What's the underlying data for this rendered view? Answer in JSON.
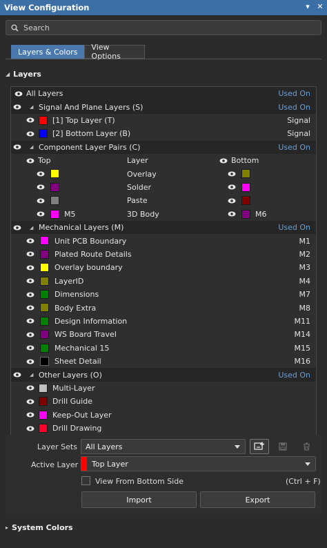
{
  "title": "View Configuration",
  "search": {
    "placeholder": "Search"
  },
  "tabs": [
    {
      "label": "Layers & Colors",
      "active": true
    },
    {
      "label": "View Options",
      "active": false
    }
  ],
  "layers_section": {
    "title": "Layers",
    "all_layers": {
      "label": "All Layers",
      "right": "Used On"
    },
    "signal_group": {
      "label": "Signal And Plane Layers (S)",
      "right": "Used On",
      "items": [
        {
          "label": "[1] Top Layer (T)",
          "color": "#ff0000",
          "right": "Signal"
        },
        {
          "label": "[2] Bottom Layer (B)",
          "color": "#0000ff",
          "right": "Signal"
        }
      ]
    },
    "pairs_group": {
      "label": "Component Layer Pairs (C)",
      "right": "Used On",
      "header": {
        "top": "Top",
        "layer": "Layer",
        "bottom": "Bottom"
      },
      "items": [
        {
          "top_color": "#ffff00",
          "top_label": "",
          "layer": "Overlay",
          "bottom_color": "#808000",
          "bottom_label": ""
        },
        {
          "top_color": "#800080",
          "top_label": "",
          "layer": "Solder",
          "bottom_color": "#ff00ff",
          "bottom_label": ""
        },
        {
          "top_color": "#808080",
          "top_label": "",
          "layer": "Paste",
          "bottom_color": "#800000",
          "bottom_label": ""
        },
        {
          "top_color": "#ff00ff",
          "top_label": "M5",
          "layer": "3D Body",
          "bottom_color": "#800080",
          "bottom_label": "M6"
        }
      ]
    },
    "mech_group": {
      "label": "Mechanical Layers (M)",
      "right": "Used On",
      "items": [
        {
          "label": "Unit PCB Boundary",
          "color": "#ff00ff",
          "right": "M1"
        },
        {
          "label": "Plated Route Details",
          "color": "#800080",
          "right": "M2"
        },
        {
          "label": "Overlay boundary",
          "color": "#ffff00",
          "right": "M3"
        },
        {
          "label": "LayerID",
          "color": "#808000",
          "right": "M4"
        },
        {
          "label": "Dimensions",
          "color": "#008000",
          "right": "M7"
        },
        {
          "label": "Body Extra",
          "color": "#808000",
          "right": "M8"
        },
        {
          "label": "Design Information",
          "color": "#008000",
          "right": "M11"
        },
        {
          "label": "WS Board Travel",
          "color": "#800080",
          "right": "M14"
        },
        {
          "label": "Mechanical 15",
          "color": "#008000",
          "right": "M15"
        },
        {
          "label": "Sheet Detail",
          "color": "#000000",
          "right": "M16"
        }
      ]
    },
    "other_group": {
      "label": "Other Layers (O)",
      "right": "Used On",
      "items": [
        {
          "label": "Multi-Layer",
          "color": "#c0c0c0"
        },
        {
          "label": "Drill Guide",
          "color": "#800000"
        },
        {
          "label": "Keep-Out Layer",
          "color": "#ff00ff"
        },
        {
          "label": "Drill Drawing",
          "color": "#ff002a"
        }
      ]
    }
  },
  "layer_sets": {
    "label": "Layer Sets",
    "value": "All Layers"
  },
  "active_layer": {
    "label": "Active Layer",
    "value": "Top Layer",
    "color": "#ff0000"
  },
  "view_from_bottom": {
    "label": "View From Bottom Side",
    "shortcut": "(Ctrl + F)"
  },
  "buttons": {
    "import": "Import",
    "export": "Export"
  },
  "system_colors": {
    "title": "System Colors"
  },
  "icons": {
    "eye": "eye-icon",
    "search": "search-icon",
    "save": "save-icon",
    "delete": "trash-icon",
    "add": "add-layer-set-icon"
  }
}
